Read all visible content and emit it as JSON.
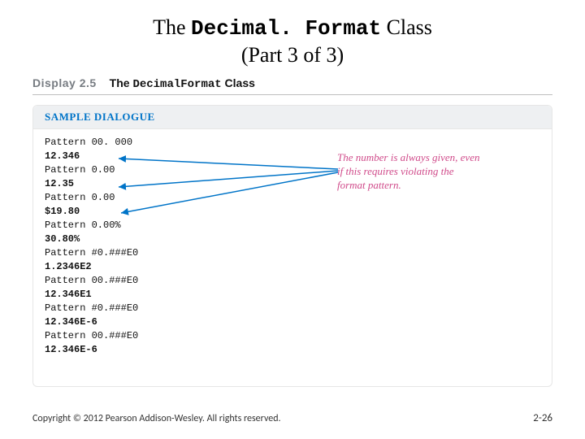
{
  "title": {
    "prefix": "The ",
    "mono": "Decimal. Format",
    "suffix": " Class",
    "subtitle": "(Part 3 of 3)"
  },
  "display_header": {
    "label": "Display 2.5",
    "title_prefix": "The ",
    "title_mono": "DecimalFormat",
    "title_suffix": " Class"
  },
  "panel": {
    "head": "SAMPLE DIALOGUE",
    "lines": [
      {
        "text": "Pattern 00. 000",
        "bold": false
      },
      {
        "text": "12.346",
        "bold": true
      },
      {
        "text": "Pattern 0.00",
        "bold": false
      },
      {
        "text": "12.35",
        "bold": true
      },
      {
        "text": "Pattern 0.00",
        "bold": false
      },
      {
        "text": "$19.80",
        "bold": true
      },
      {
        "text": "Pattern 0.00%",
        "bold": false
      },
      {
        "text": "30.80%",
        "bold": true
      },
      {
        "text": "Pattern #0.###E0",
        "bold": false
      },
      {
        "text": "1.2346E2",
        "bold": true
      },
      {
        "text": "Pattern 00.###E0",
        "bold": false
      },
      {
        "text": "12.346E1",
        "bold": true
      },
      {
        "text": "Pattern #0.###E0",
        "bold": false
      },
      {
        "text": "12.346E-6",
        "bold": true
      },
      {
        "text": "Pattern 00.###E0",
        "bold": false
      },
      {
        "text": "12.346E-6",
        "bold": true
      }
    ]
  },
  "callout": {
    "line1": "The number is always given, even",
    "line2": "if this requires violating the",
    "line3": "format pattern."
  },
  "footer": {
    "left": "Copyright © 2012 Pearson Addison-Wesley. All rights reserved.",
    "right": "2-26"
  }
}
